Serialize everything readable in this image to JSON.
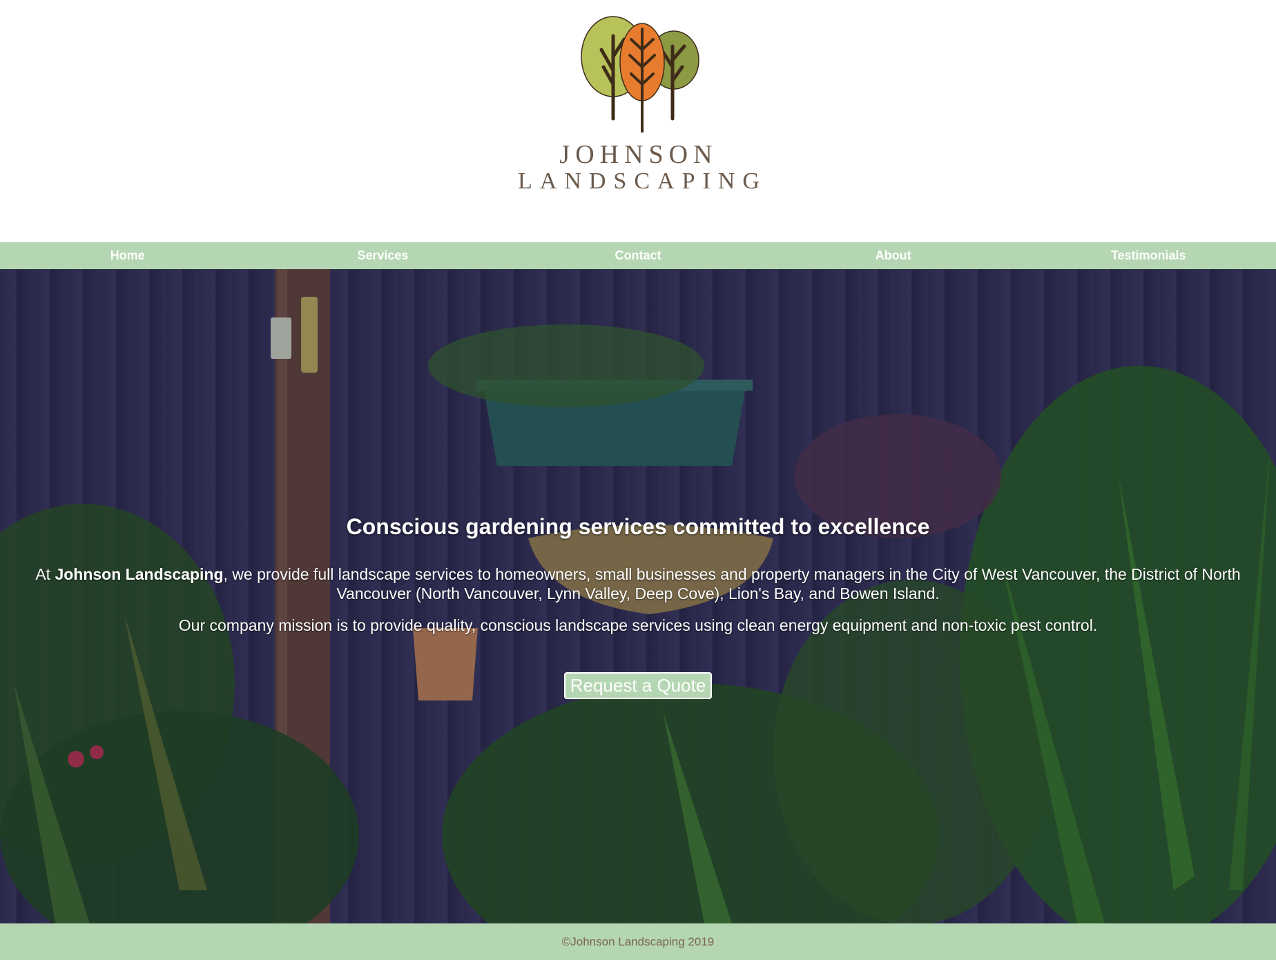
{
  "logo": {
    "line1": "JOHNSON",
    "line2": "LANDSCAPING",
    "icon": "three-trees-logo"
  },
  "nav": {
    "items": [
      {
        "label": "Home"
      },
      {
        "label": "Services"
      },
      {
        "label": "Contact"
      },
      {
        "label": "About"
      },
      {
        "label": "Testimonials"
      }
    ]
  },
  "hero": {
    "title": "Conscious gardening services committed to excellence",
    "intro_prefix": "At ",
    "intro_brand": "Johnson Landscaping",
    "intro_rest": ", we provide full landscape services to homeowners, small businesses and property managers in the City of West Vancouver, the District of North Vancouver (North Vancouver, Lynn Valley, Deep Cove), Lion's Bay, and Bowen Island.",
    "mission": "Our company mission is to provide quality, conscious landscape services using clean energy equipment and non-toxic pest control.",
    "button_label": "Request a Quote",
    "background": "garden-fence-plants-photo"
  },
  "footer": {
    "text": "©Johnson Landscaping 2019"
  },
  "colors": {
    "accent": "#b5d6b2",
    "logo_text": "#6b5a4c",
    "footer_text": "#7a6650"
  }
}
